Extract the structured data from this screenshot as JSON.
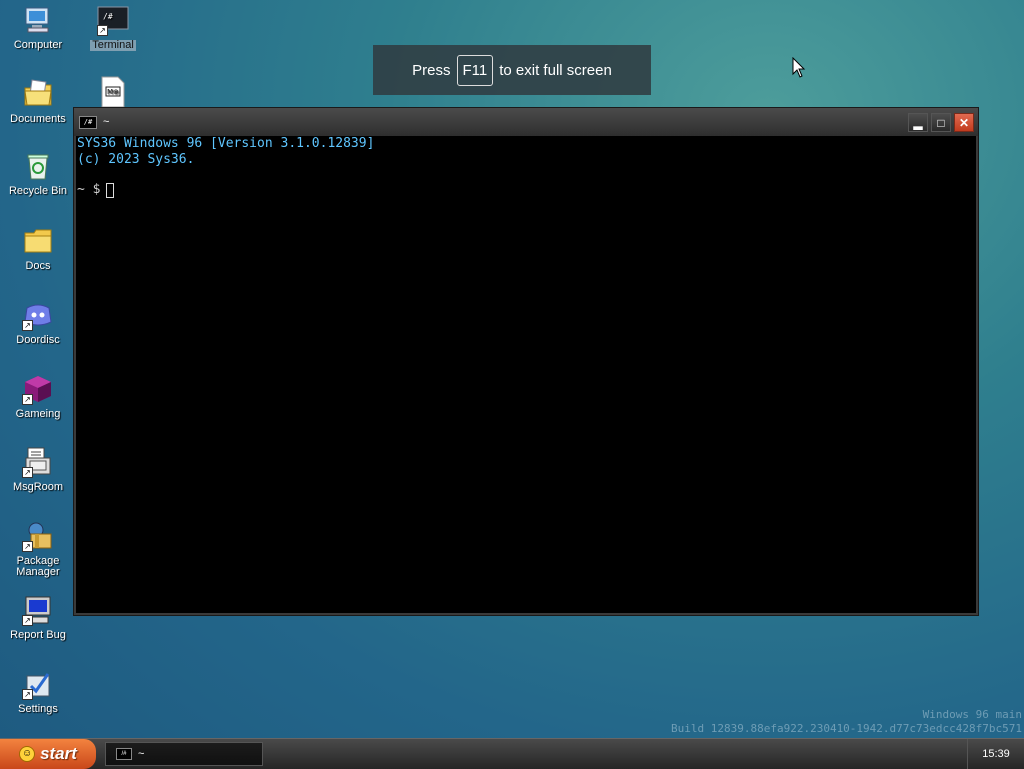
{
  "desktop": {
    "icons": [
      {
        "label": "Computer",
        "icon": "computer-icon"
      },
      {
        "label": "Documents",
        "icon": "documents-icon"
      },
      {
        "label": "Recycle Bin",
        "icon": "recycle-bin-icon"
      },
      {
        "label": "Docs",
        "icon": "folder-icon"
      },
      {
        "label": "Doordisc",
        "icon": "doordisc-icon"
      },
      {
        "label": "Gameing",
        "icon": "game-cube-icon"
      },
      {
        "label": "MsgRoom",
        "icon": "msgroom-icon"
      },
      {
        "label": "Package Manager",
        "icon": "package-manager-icon"
      },
      {
        "label": "Report Bug",
        "icon": "report-bug-icon"
      },
      {
        "label": "Settings",
        "icon": "settings-icon"
      },
      {
        "label": "Terminal",
        "icon": "terminal-icon"
      },
      {
        "label": "",
        "icon": "markdown-file-icon",
        "glyph": "M⊕"
      }
    ]
  },
  "fullscreen_toast": {
    "before": "Press",
    "key": "F11",
    "after": "to exit full screen"
  },
  "terminal_window": {
    "title": "~",
    "icon_glyph": "/#",
    "lines": [
      "SYS36 Windows 96 [Version 3.1.0.12839]",
      "(c) 2023 Sys36."
    ],
    "prompt": "~ $"
  },
  "watermark": {
    "line1": "Windows 96 main",
    "line2": "Build 12839.88efa922.230410-1942.d77c73edcc428f7bc571"
  },
  "taskbar": {
    "start_label": "start",
    "task_label": "~",
    "clock": "15:39"
  },
  "colors": {
    "console_text": "#5fc6ff",
    "start_orange": "#e8692e",
    "close_red": "#d04a2c"
  }
}
